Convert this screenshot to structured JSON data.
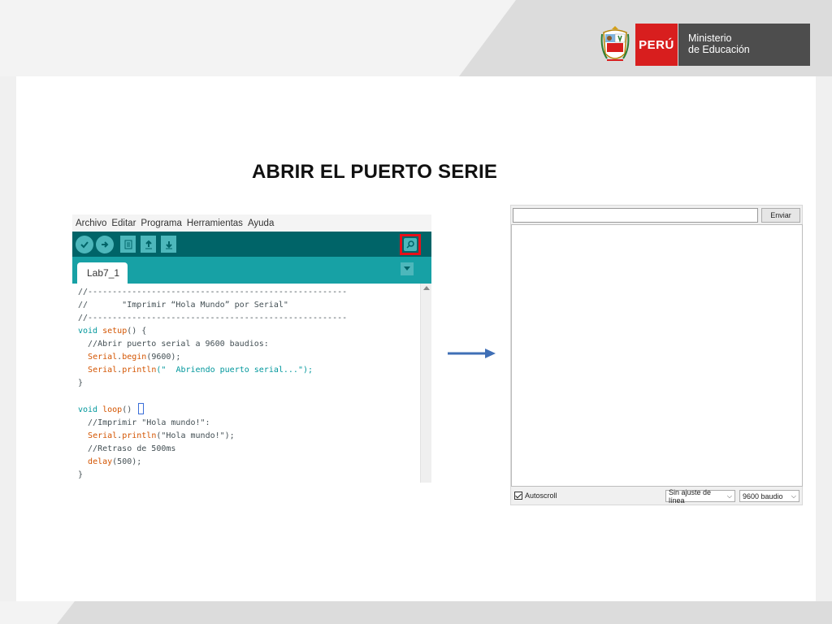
{
  "slide": {
    "title": "ABRIR EL PUERTO SERIE"
  },
  "logo": {
    "country": "PERÚ",
    "ministry_line1": "Ministerio",
    "ministry_line2": "de Educación",
    "colors": {
      "red": "#d81e1e",
      "gray": "#4d4d4d"
    }
  },
  "ide": {
    "menu": [
      "Archivo",
      "Editar",
      "Programa",
      "Herramientas",
      "Ayuda"
    ],
    "toolbar_icons": [
      "verify-icon",
      "upload-icon",
      "new-file-icon",
      "open-file-icon",
      "save-file-icon"
    ],
    "serial_monitor_icon": "magnifier-icon",
    "tab_label": "Lab7_1",
    "code": {
      "l1": "//-----------------------------------------------------",
      "l2": "//       \"Imprimir “Hola Mundo” por Serial\"",
      "l3": "//-----------------------------------------------------",
      "l4_kw": "void",
      "l4_fn": "setup",
      "l4_rest": "() {",
      "l5": "  //Abrir puerto serial a 9600 baudios:",
      "l6_obj": "Serial",
      "l6_fn": "begin",
      "l6_rest": "(9600);",
      "l7_obj": "Serial",
      "l7_fn": "println",
      "l7_rest": "(\"  Abriendo puerto serial...\");",
      "l8": "}",
      "l10_kw": "void",
      "l10_fn": "loop",
      "l10_rest": "() ",
      "l11": "  //Imprimir \"Hola mundo!\":",
      "l12_obj": "Serial",
      "l12_fn": "println",
      "l12_rest": "(\"Hola mundo!\");",
      "l13": "  //Retraso de 500ms",
      "l14_fn": "delay",
      "l14_rest": "(500);",
      "l15": "}"
    },
    "colors": {
      "toolbar": "#006468",
      "tabbar": "#17a1a5",
      "highlight": "#e8101a"
    }
  },
  "serial_monitor": {
    "input_value": "",
    "send_label": "Enviar",
    "autoscroll_label": "Autoscroll",
    "autoscroll_checked": true,
    "line_ending": "Sin ajuste de línea",
    "baud_rate": "9600 baudio"
  }
}
